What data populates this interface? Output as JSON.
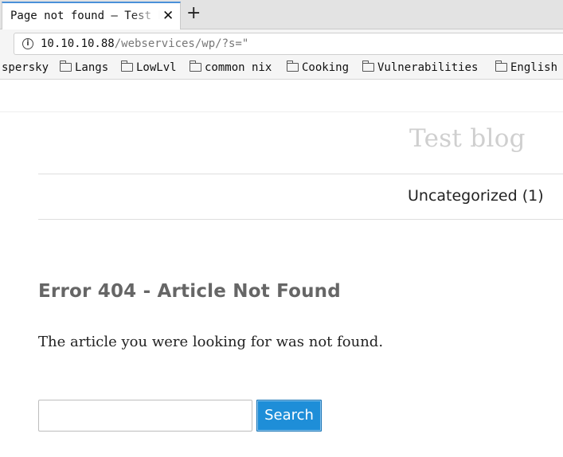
{
  "browser": {
    "tab": {
      "title": "Page not found – Test blog",
      "close_icon": "✕"
    },
    "new_tab_icon": "+",
    "url": {
      "host": "10.10.10.88",
      "path": "/webservices/wp/?s=\""
    },
    "bookmarks": [
      "spersky",
      "Langs",
      "LowLvl",
      "common nix",
      "Cooking",
      "Vulnerabilities",
      "English"
    ]
  },
  "site": {
    "title": "Test blog",
    "menu": [
      {
        "label": "Uncategorized (1)"
      }
    ]
  },
  "content": {
    "heading": "Error 404 - Article Not Found",
    "message": "The article you were looking for was not found."
  },
  "search": {
    "value": "",
    "button_label": "Search"
  },
  "colors": {
    "accent": "#1e8ed8",
    "site_title": "#cfcfcf"
  }
}
